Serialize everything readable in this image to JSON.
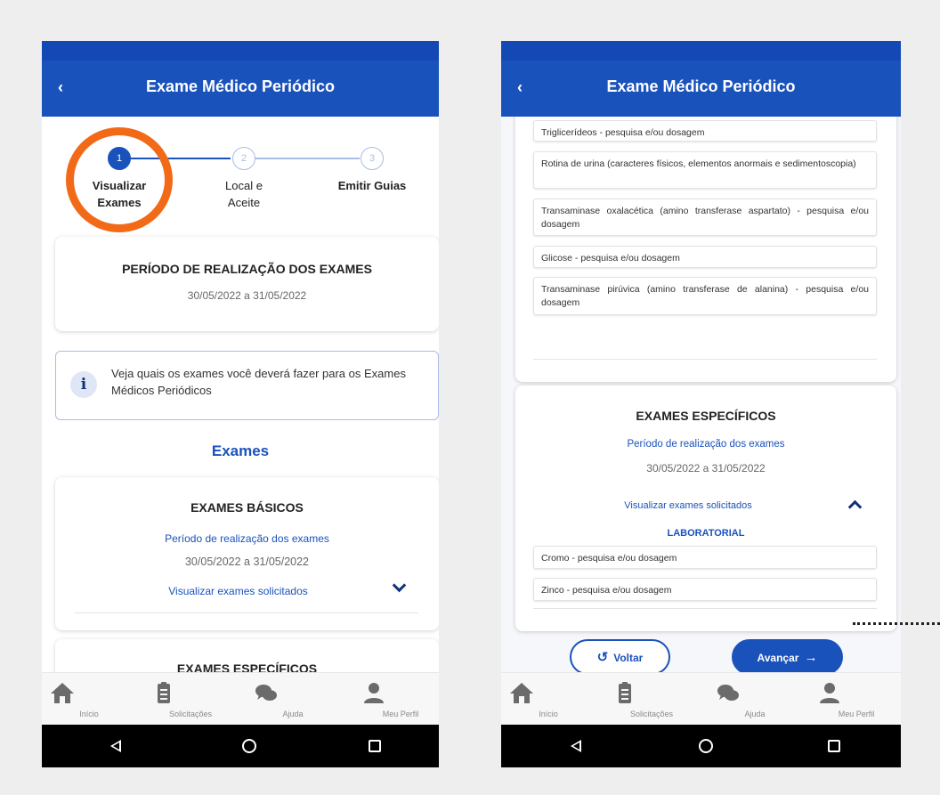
{
  "app": {
    "title": "Exame Médico Periódico",
    "back_icon": "‹"
  },
  "stepper": {
    "steps": [
      {
        "number": "1",
        "label_line1": "Visualizar",
        "label_line2": "Exames",
        "state": "active"
      },
      {
        "number": "2",
        "label_line1": "Local e",
        "label_line2": "Aceite",
        "state": "inactive"
      },
      {
        "number": "3",
        "label_line1": "Emitir Guias",
        "label_line2": "",
        "state": "inactive"
      }
    ]
  },
  "periodo": {
    "title": "PERÍODO DE REALIZAÇÃO DOS EXAMES",
    "dates": "30/05/2022 a 31/05/2022"
  },
  "info": {
    "icon": "i",
    "text": "Veja quais os exames você deverá fazer para os Exames Médicos Periódicos"
  },
  "exames_title": "Exames",
  "basicos": {
    "title": "EXAMES BÁSICOS",
    "periodo_label": "Período de realização dos exames",
    "dates": "30/05/2022 a 31/05/2022",
    "link": "Visualizar exames solicitados"
  },
  "especificos_title": "EXAMES ESPECÍFICOS",
  "exam_list": [
    "Triglicerídeos - pesquisa e/ou dosagem",
    "Rotina de urina (caracteres físicos, elementos anormais e sedimentoscopia)",
    "Transaminase oxalacética (amino transferase aspartato) - pesquisa e/ou dosagem",
    "Glicose - pesquisa e/ou dosagem",
    "Transaminase pirúvica (amino transferase de alanina) - pesquisa e/ou dosagem"
  ],
  "especificos": {
    "title": "EXAMES ESPECÍFICOS",
    "periodo_label": "Período de realização dos exames",
    "dates": "30/05/2022 a 31/05/2022",
    "link": "Visualizar exames solicitados",
    "category": "LABORATORIAL",
    "items": [
      "Cromo - pesquisa e/ou dosagem",
      "Zinco - pesquisa e/ou dosagem"
    ]
  },
  "buttons": {
    "voltar": "Voltar",
    "voltar_icon": "↺",
    "avancar": "Avançar",
    "avancar_icon": "→"
  },
  "bottom_nav": [
    {
      "label": "Início",
      "icon": "home-icon"
    },
    {
      "label": "Solicitações",
      "icon": "clipboard-icon"
    },
    {
      "label": "Ajuda",
      "icon": "chat-icon"
    },
    {
      "label": "Meu Perfil",
      "icon": "user-icon"
    }
  ],
  "colors": {
    "primary": "#1a52bc",
    "highlight": "#f26a17",
    "nav_icon": "#6b6b6b"
  }
}
